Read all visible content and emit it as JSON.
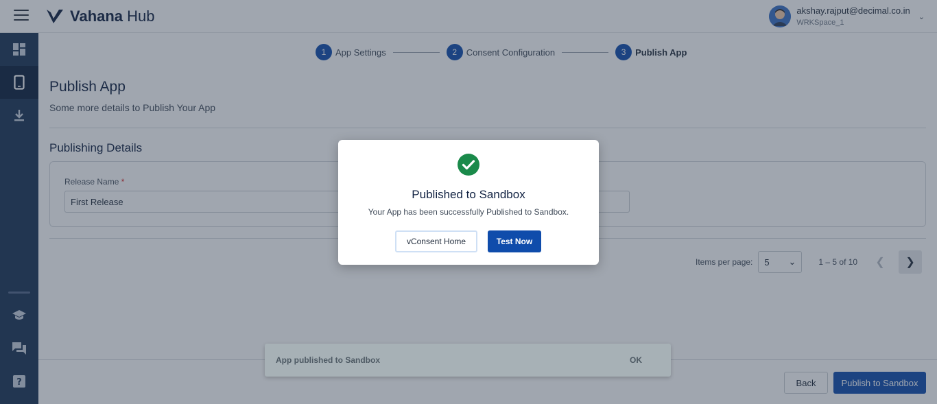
{
  "app": {
    "brand_bold": "Vahana",
    "brand_light": "Hub"
  },
  "user": {
    "email": "akshay.rajput@decimal.co.in",
    "workspace": "WRKSpace_1"
  },
  "sidebar": {
    "items": [
      {
        "icon": "dashboard-icon"
      },
      {
        "icon": "mobile-app-icon",
        "active": true
      },
      {
        "icon": "download-icon"
      },
      {
        "icon": "school-icon"
      },
      {
        "icon": "forum-icon"
      },
      {
        "icon": "help-icon"
      }
    ]
  },
  "stepper": {
    "steps": [
      {
        "num": "1",
        "label": "App Settings"
      },
      {
        "num": "2",
        "label": "Consent Configuration"
      },
      {
        "num": "3",
        "label": "Publish App"
      }
    ]
  },
  "page": {
    "title": "Publish App",
    "subtitle": "Some more details to Publish Your App",
    "section_title": "Publishing Details",
    "release_label": "Release Name",
    "release_required": "*",
    "release_value": "First Release"
  },
  "pagination": {
    "items_per_page_label": "Items per page:",
    "per_page": "5",
    "range": "1 – 5 of 10"
  },
  "footer": {
    "back": "Back",
    "publish": "Publish to Sandbox"
  },
  "snackbar": {
    "message": "App published to Sandbox",
    "action": "OK"
  },
  "modal": {
    "title": "Published to Sandbox",
    "message": "Your App has been successfully Published to Sandbox.",
    "secondary_button": "vConsent Home",
    "primary_button": "Test Now"
  },
  "colors": {
    "primary": "#0f4cab",
    "sidebar": "#1b3354",
    "success": "#1a8a4a"
  }
}
